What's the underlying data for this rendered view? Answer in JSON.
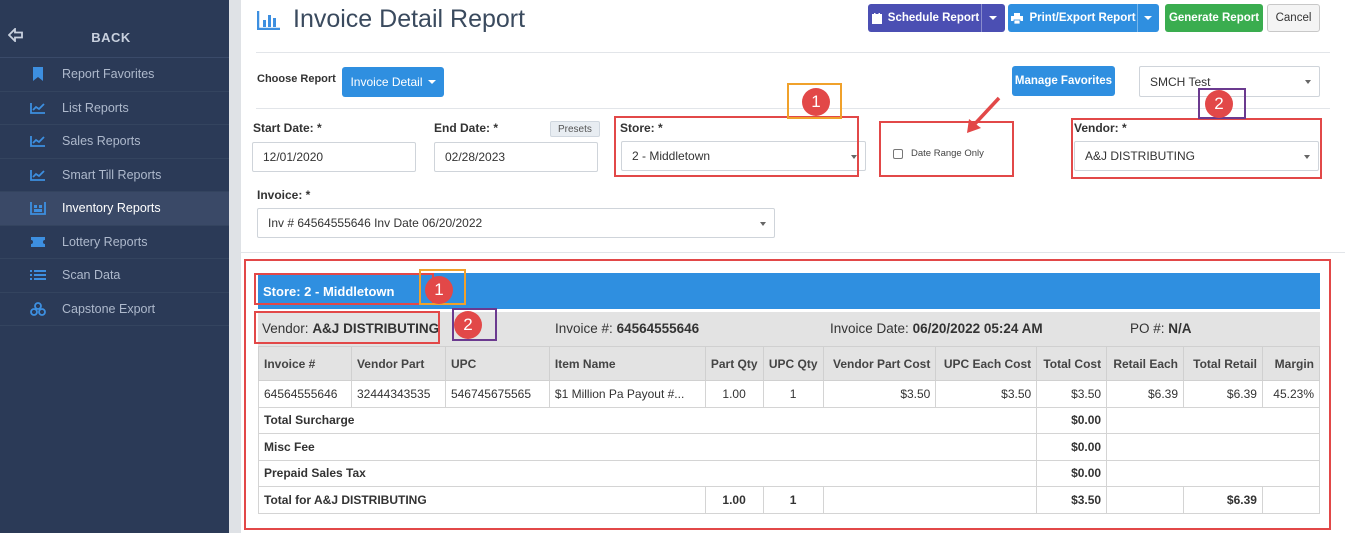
{
  "sidebar": {
    "back_label": "BACK",
    "items": [
      {
        "label": "Report Favorites",
        "icon": "bookmark-icon"
      },
      {
        "label": "List Reports",
        "icon": "line-chart-icon"
      },
      {
        "label": "Sales Reports",
        "icon": "line-chart-icon"
      },
      {
        "label": "Smart Till Reports",
        "icon": "line-chart-icon"
      },
      {
        "label": "Inventory Reports",
        "icon": "inventory-icon"
      },
      {
        "label": "Lottery Reports",
        "icon": "ticket-icon"
      },
      {
        "label": "Scan Data",
        "icon": "list-icon"
      },
      {
        "label": "Capstone Export",
        "icon": "boxes-icon"
      }
    ]
  },
  "header": {
    "title": "Invoice Detail Report",
    "schedule_label": "Schedule Report",
    "print_label": "Print/Export Report",
    "generate_label": "Generate Report",
    "cancel_label": "Cancel"
  },
  "choose": {
    "label": "Choose Report",
    "button_label": "Invoice Detail",
    "manage_label": "Manage Favorites",
    "favorite_value": "SMCH Test"
  },
  "filters": {
    "start_label": "Start Date: *",
    "start_value": "12/01/2020",
    "end_label": "End Date: *",
    "end_value": "02/28/2023",
    "presets_label": "Presets",
    "store_label": "Store: *",
    "store_value": "2 - Middletown",
    "date_range_label": "Date Range Only",
    "vendor_label": "Vendor: *",
    "vendor_value": "A&J DISTRIBUTING",
    "invoice_label": "Invoice: *",
    "invoice_value": "Inv # 64564555646 Inv Date 06/20/2022"
  },
  "annotations": {
    "one": "1",
    "two": "2"
  },
  "report": {
    "store_heading": "Store: 2 - Middletown",
    "vendor_label": "Vendor:",
    "vendor_value": "A&J DISTRIBUTING",
    "invoice_label": "Invoice #:",
    "invoice_value": "64564555646",
    "date_label": "Invoice Date:",
    "date_value": "06/20/2022 05:24 AM",
    "po_label": "PO #:",
    "po_value": "N/A",
    "columns": [
      "Invoice #",
      "Vendor Part",
      "UPC",
      "Item Name",
      "Part Qty",
      "UPC Qty",
      "Vendor Part Cost",
      "UPC Each Cost",
      "Total Cost",
      "Retail Each",
      "Total Retail",
      "Margin"
    ],
    "row": [
      "64564555646",
      "32444343535",
      "546745675565",
      "$1 Million Pa Payout #...",
      "1.00",
      "1",
      "$3.50",
      "$3.50",
      "$3.50",
      "$6.39",
      "$6.39",
      "45.23%"
    ],
    "surcharge_label": "Total Surcharge",
    "surcharge_value": "$0.00",
    "misc_label": "Misc Fee",
    "misc_value": "$0.00",
    "prepaid_label": "Prepaid Sales Tax",
    "prepaid_value": "$0.00",
    "total_label": "Total for A&J DISTRIBUTING",
    "total_part_qty": "1.00",
    "total_upc_qty": "1",
    "total_cost": "$3.50",
    "total_retail": "$6.39"
  }
}
